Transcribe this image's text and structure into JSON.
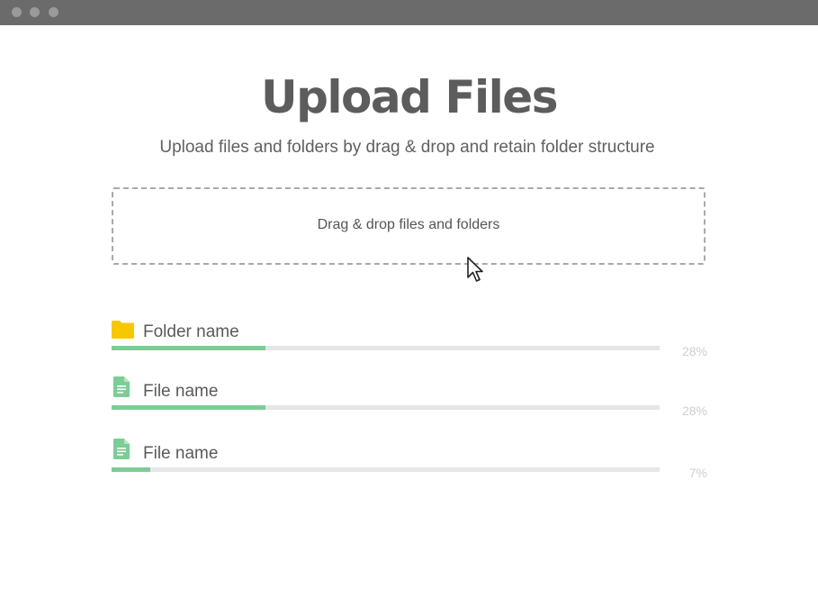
{
  "window": {
    "controls": [
      "window-dot",
      "window-dot",
      "window-dot"
    ]
  },
  "header": {
    "title": "Upload Files",
    "subtitle": "Upload files and folders by drag & drop and retain folder structure"
  },
  "dropzone": {
    "label": "Drag & drop files and folders"
  },
  "uploads": [
    {
      "name": "Folder name",
      "type": "folder",
      "icon": "folder-icon",
      "progress": 0.28,
      "percent_label": "28%"
    },
    {
      "name": "File name",
      "type": "file",
      "icon": "file-icon",
      "progress": 0.28,
      "percent_label": "28%"
    },
    {
      "name": "File name",
      "type": "file",
      "icon": "file-icon",
      "progress": 0.07,
      "percent_label": "7%"
    }
  ],
  "colors": {
    "titlebar": "#6b6b6b",
    "progress_fill": "#7ccd95",
    "progress_track": "#e6e6e6",
    "folder": "#f7c800",
    "file": "#7ccd95"
  }
}
